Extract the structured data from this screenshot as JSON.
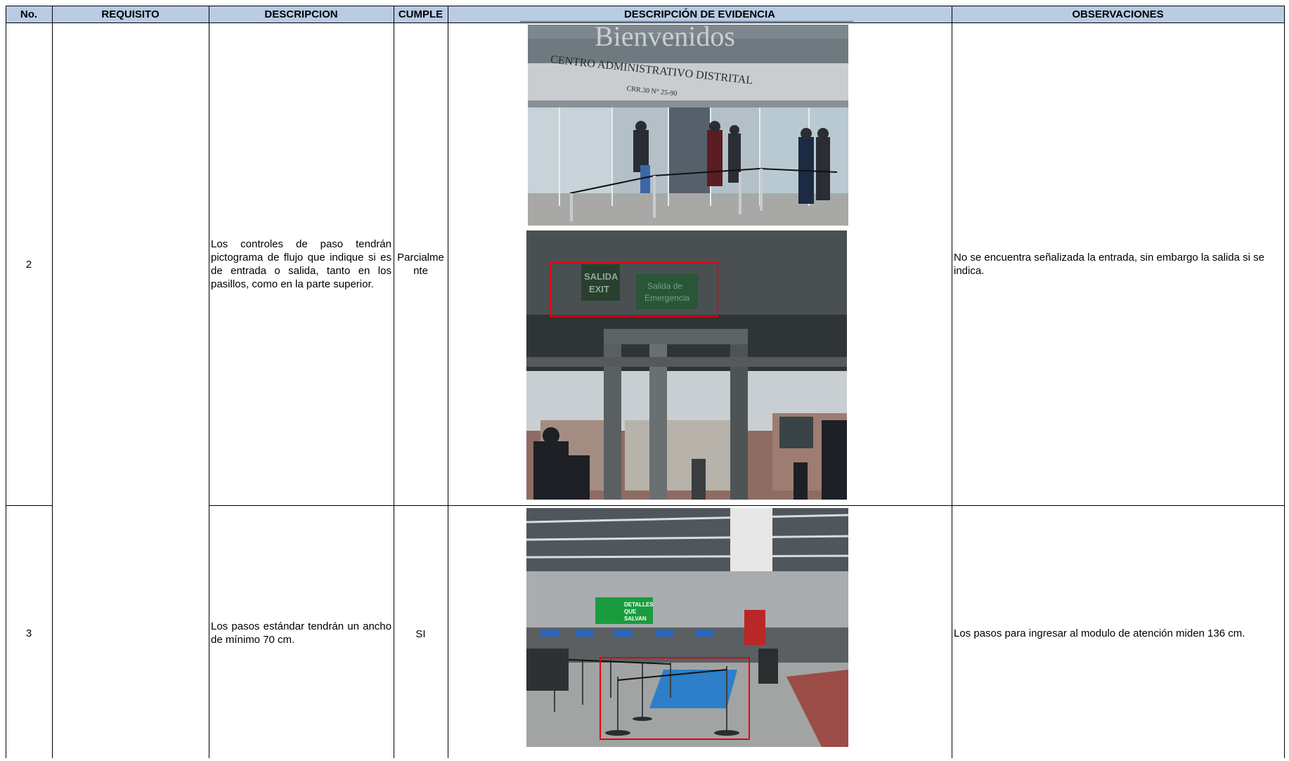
{
  "header": {
    "no": "No.",
    "requisito": "REQUISITO",
    "descripcion": "DESCRIPCION",
    "cumple": "CUMPLE",
    "evidencia": "DESCRIPCIÓN DE EVIDENCIA",
    "observaciones": "OBSERVACIONES"
  },
  "rows": [
    {
      "no": "2",
      "requisito": "",
      "descripcion": "Los controles de paso tendrán pictograma de flujo que indique si es de entrada o salida, tanto en los pasillos, como en la parte superior.",
      "cumple_line1": "Parcialme",
      "cumple_line2": "nte",
      "observaciones": "No se encuentra señalizada la entrada, sin embargo la salida si se indica.",
      "photo1": {
        "sign_line1": "Bienvenidos",
        "sign_line2": "CENTRO ADMINISTRATIVO DISTRITAL",
        "sign_line3": "CRR.30 N° 25-90"
      },
      "photo2": {
        "sign_exit_1": "SALIDA",
        "sign_exit_2": "EXIT",
        "sign_emerg_1": "Salida de",
        "sign_emerg_2": "Emergencia"
      }
    },
    {
      "no": "3",
      "requisito": "",
      "descripcion": "Los pasos estándar tendrán un ancho de mínimo 70 cm.",
      "cumple": "SI",
      "observaciones": "Los pasos para ingresar al modulo de atención miden 136 cm.",
      "photo3": {
        "banner_1": "DETALLES",
        "banner_2": "QUE",
        "banner_3": "SALVAN"
      }
    }
  ],
  "colors": {
    "header_bg": "#b8cce4",
    "annotation_red": "#e3000f"
  }
}
